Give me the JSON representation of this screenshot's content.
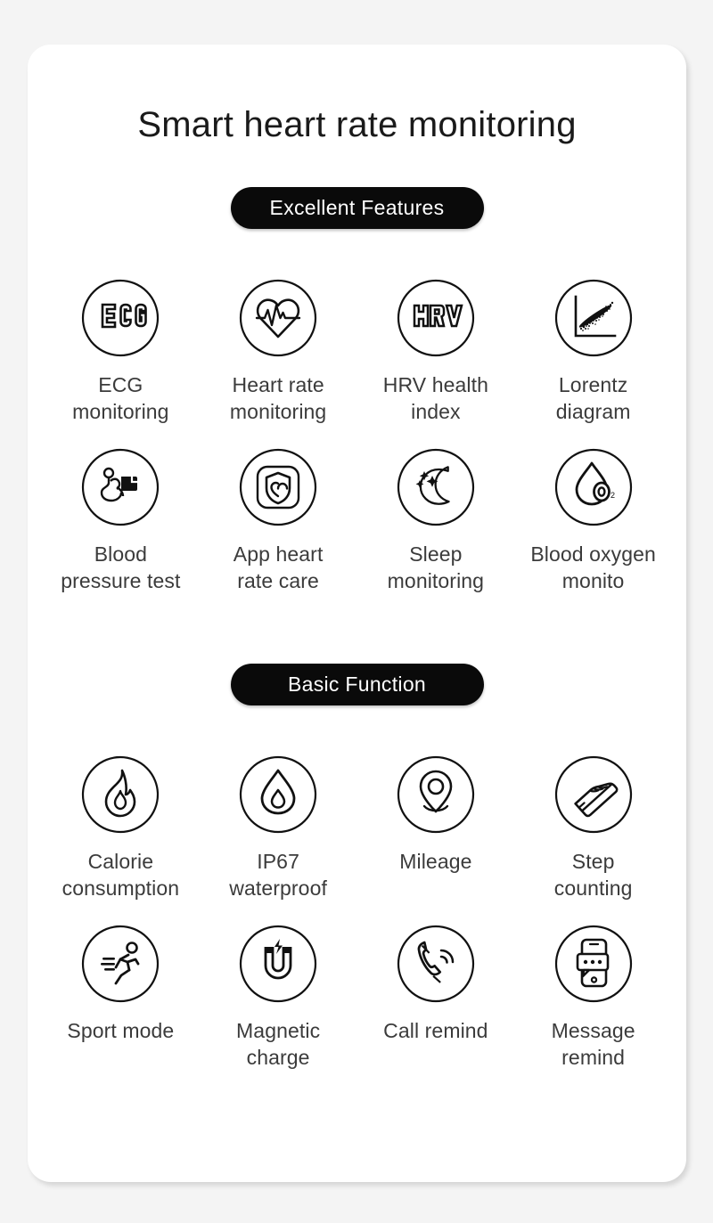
{
  "page": {
    "title": "Smart heart rate monitoring",
    "background_color": "#f4f4f4",
    "card_color": "#ffffff",
    "text_color": "#3b3b3b",
    "accent_color": "#0a0a0a"
  },
  "sections": [
    {
      "badge": "Excellent Features",
      "features": [
        {
          "icon": "ecg-icon",
          "label": "ECG\nmonitoring"
        },
        {
          "icon": "heart-pulse-icon",
          "label": "Heart rate\nmonitoring"
        },
        {
          "icon": "hrv-icon",
          "label": "HRV health\nindex"
        },
        {
          "icon": "lorentz-scatter-icon",
          "label": "Lorentz\ndiagram"
        },
        {
          "icon": "blood-pressure-icon",
          "label": "Blood\npressure test"
        },
        {
          "icon": "shield-heart-icon",
          "label": "App heart\nrate care"
        },
        {
          "icon": "moon-stars-icon",
          "label": "Sleep\nmonitoring"
        },
        {
          "icon": "blood-oxygen-icon",
          "label": "Blood oxygen\nmonito"
        }
      ]
    },
    {
      "badge": "Basic Function",
      "features": [
        {
          "icon": "flame-icon",
          "label": "Calorie\nconsumption"
        },
        {
          "icon": "water-drop-icon",
          "label": "IP67\nwaterproof"
        },
        {
          "icon": "location-pin-icon",
          "label": "Mileage"
        },
        {
          "icon": "sneaker-icon",
          "label": "Step\ncounting"
        },
        {
          "icon": "running-person-icon",
          "label": "Sport mode"
        },
        {
          "icon": "magnet-bolt-icon",
          "label": "Magnetic\ncharge"
        },
        {
          "icon": "phone-call-icon",
          "label": "Call remind"
        },
        {
          "icon": "phone-message-icon",
          "label": "Message\nremind"
        }
      ]
    }
  ]
}
